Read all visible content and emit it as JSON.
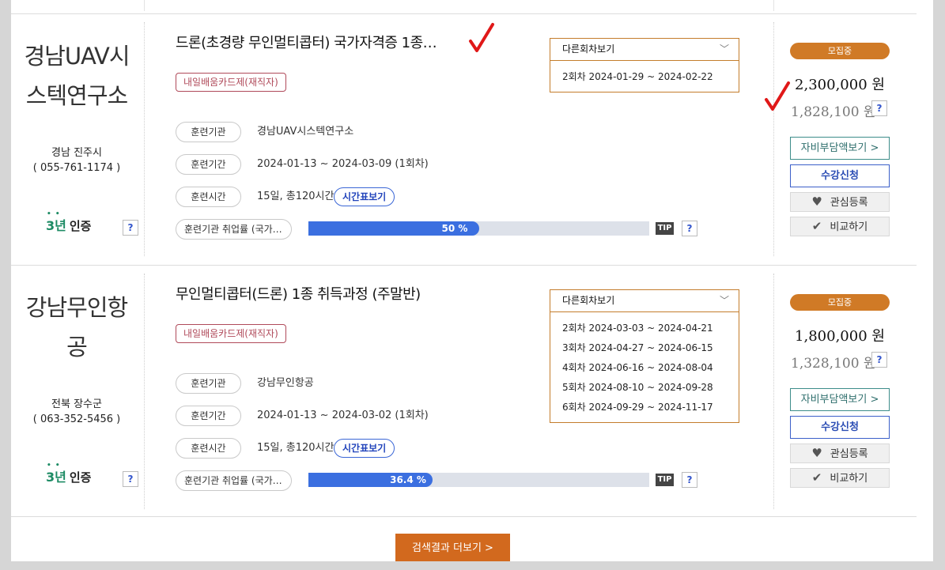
{
  "courses": [
    {
      "org_name": "경남UAV시스템연구소",
      "org_name_line1": "경남UAV시",
      "org_name_line2": "스텍연구소",
      "location": "경남 진주시",
      "phone": "( 055-761-1174 )",
      "cert_num": "3년",
      "cert_label": "인증",
      "title": "드론(초경량 무인멀티콥터) 국가자격증 1종…",
      "tag": "내일배움카드제(재직자)",
      "info": {
        "institution_label": "훈련기관",
        "institution": "경남UAV시스텍연구소",
        "period_label": "훈련기간",
        "period": "2024-01-13 ~ 2024-03-09 (1회차)",
        "time_label": "훈련시간",
        "time": "15일, 총120시간",
        "timetable_button": "시간표보기",
        "employment_label": "훈련기관 취업률 (국가…",
        "employment_rate": 50,
        "employment_text": "50 %",
        "tip": "TIP"
      },
      "sessions_header": "다른회차보기",
      "sessions": [
        "2회차 2024-01-29 ~ 2024-02-22"
      ],
      "status": "모집중",
      "price": "2,300,000 원",
      "price_after": "1,828,100 원",
      "self_pay_button": "자비부담액보기 >",
      "apply_button": "수강신청",
      "wish_button": "관심등록",
      "compare_button": "비교하기"
    },
    {
      "org_name_line1": "강남무인항",
      "org_name_line2": "공",
      "location": "전북 장수군",
      "phone": "( 063-352-5456 )",
      "cert_num": "3년",
      "cert_label": "인증",
      "title": "무인멀티콥터(드론) 1종 취득과정 (주말반)",
      "tag": "내일배움카드제(재직자)",
      "info": {
        "institution_label": "훈련기관",
        "institution": "강남무인항공",
        "period_label": "훈련기간",
        "period": "2024-01-13 ~ 2024-03-02 (1회차)",
        "time_label": "훈련시간",
        "time": "15일, 총120시간",
        "timetable_button": "시간표보기",
        "employment_label": "훈련기관 취업률 (국가…",
        "employment_rate": 36.4,
        "employment_text": "36.4 %",
        "tip": "TIP"
      },
      "sessions_header": "다른회차보기",
      "sessions": [
        "2회차 2024-03-03 ~ 2024-04-21",
        "3회차 2024-04-27 ~ 2024-06-15",
        "4회차 2024-06-16 ~ 2024-08-04",
        "5회차 2024-08-10 ~ 2024-09-28",
        "6회차 2024-09-29 ~ 2024-11-17"
      ],
      "status": "모집중",
      "price": "1,800,000 원",
      "price_after": "1,328,100 원",
      "self_pay_button": "자비부담액보기 >",
      "apply_button": "수강신청",
      "wish_button": "관심등록",
      "compare_button": "비교하기"
    }
  ],
  "more_button": "검색결과 더보기 >",
  "help_mark": "?",
  "colors": {
    "accent_orange": "#d07a26",
    "progress_blue": "#3b6fe0",
    "check_red": "#e01818"
  },
  "icons": {
    "heart": "heart-icon",
    "check": "checkmark-icon",
    "chevron": "chevron-down-icon"
  }
}
